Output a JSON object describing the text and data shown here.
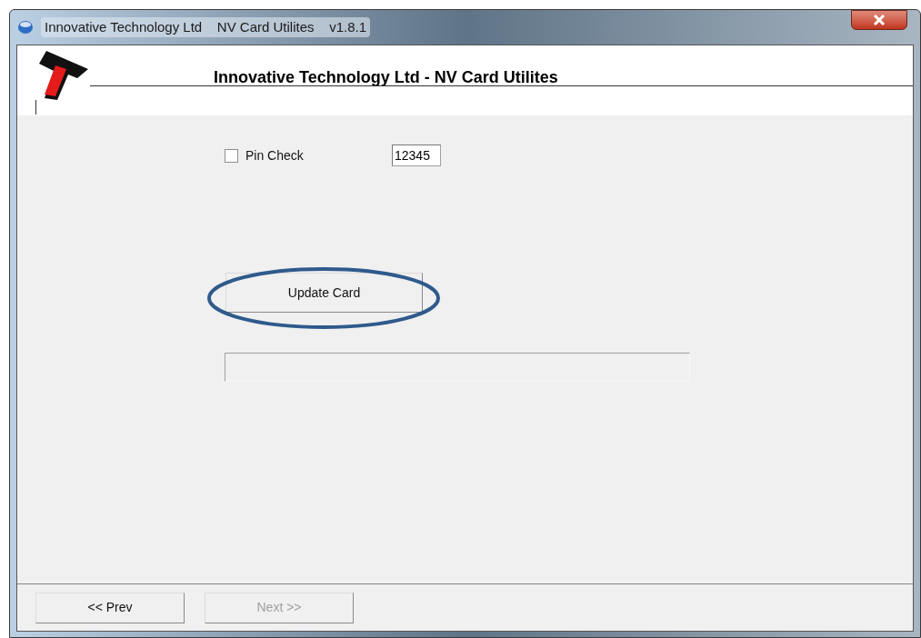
{
  "window": {
    "title": "Innovative Technology Ltd    NV Card Utilites    v1.8.1"
  },
  "header": {
    "title": "Innovative Technology Ltd - NV Card Utilites"
  },
  "pin_check": {
    "label": "Pin Check",
    "checked": false,
    "value": "12345"
  },
  "update_button": {
    "label": "Update Card",
    "highlighted": true
  },
  "footer_buttons": [
    {
      "label": "<< Prev",
      "disabled": false
    },
    {
      "label": "Next >>",
      "disabled": true
    }
  ]
}
